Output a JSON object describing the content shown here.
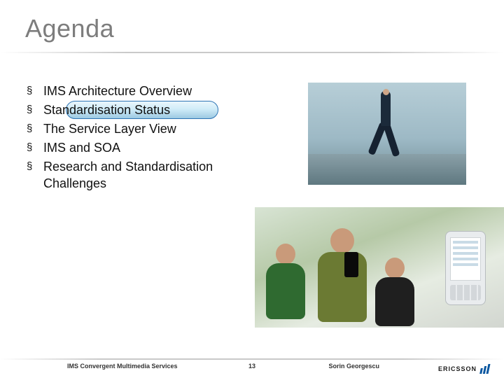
{
  "title": "Agenda",
  "bullets": [
    {
      "text": "IMS Architecture Overview",
      "highlighted": false
    },
    {
      "text": "Standardisation Status",
      "highlighted": true
    },
    {
      "text": "The Service Layer View",
      "highlighted": false
    },
    {
      "text": "IMS and SOA",
      "highlighted": false
    },
    {
      "text": "Research and Standardisation Challenges",
      "highlighted": false
    }
  ],
  "footer": {
    "left": "IMS Convergent Multimedia Services",
    "page_number": "13",
    "author": "Sorin Georgescu"
  },
  "brand": {
    "name": "ERICSSON"
  },
  "images": {
    "hero_alt": "Man stepping across gap",
    "group_alt": "People using mobile phones"
  }
}
